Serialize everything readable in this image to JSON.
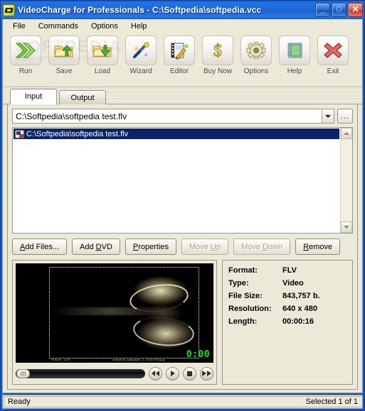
{
  "window": {
    "title": "VideoCharge for Professionals - C:\\Softpedia\\softpedia.vcc",
    "app_icon": "film-reel-icon",
    "minimize_label": "_",
    "maximize_label": "□",
    "close_label": "✕",
    "accent_blue": "#1b62d2",
    "face_color": "#ece9d8"
  },
  "menu": {
    "items": [
      {
        "label": "File"
      },
      {
        "label": "Commands"
      },
      {
        "label": "Options"
      },
      {
        "label": "Help"
      }
    ]
  },
  "toolbar": {
    "watermark": "SOFTPEDIA",
    "watermark_sub": "www.softpedia.com",
    "buttons": [
      {
        "label": "Run",
        "icon": "green-double-chevron-icon"
      },
      {
        "label": "Save",
        "icon": "folder-up-arrow-icon"
      },
      {
        "label": "Load",
        "icon": "folder-down-arrow-icon"
      },
      {
        "label": "Wizard",
        "icon": "magic-wand-icon"
      },
      {
        "label": "Editor",
        "icon": "filmstrip-pencil-icon"
      },
      {
        "label": "Buy Now",
        "icon": "dollar-sign-icon"
      },
      {
        "label": "Options",
        "icon": "gear-icon"
      },
      {
        "label": "Help",
        "icon": "notebook-icon"
      },
      {
        "label": "Exit",
        "icon": "red-x-icon"
      }
    ]
  },
  "tabs": [
    {
      "label": "Input",
      "active": true
    },
    {
      "label": "Output",
      "active": false
    }
  ],
  "input_panel": {
    "path_combo": {
      "value": "C:\\Softpedia\\softpedia test.flv",
      "placeholder": "C:\\Softpedia\\softpedia test.flv"
    },
    "browse_label": "...",
    "file_list": [
      {
        "name": "C:\\Softpedia\\softpedia test.flv",
        "selected": true
      }
    ],
    "buttons": [
      {
        "accel": "A",
        "rest": "dd Files...",
        "disabled": false,
        "name": "add-files-button"
      },
      {
        "pre": "Add ",
        "accel": "D",
        "rest": "VD",
        "disabled": false,
        "name": "add-dvd-button"
      },
      {
        "accel": "P",
        "rest": "roperties",
        "disabled": false,
        "name": "properties-button"
      },
      {
        "pre": "Move ",
        "accel": "U",
        "rest": "p",
        "disabled": true,
        "name": "move-up-button"
      },
      {
        "pre": "Move ",
        "accel": "D",
        "rest": "own",
        "disabled": true,
        "name": "move-down-button"
      },
      {
        "accel": "R",
        "rest": "emove",
        "disabled": false,
        "name": "remove-button"
      }
    ]
  },
  "preview": {
    "timecode": "0:00",
    "overlay_left": "Picture : 1/19",
    "overlay_right": "softpedia_wallpaper_2_1024x768.jpg",
    "transport": [
      {
        "name": "rewind-button",
        "icon": "rewind-icon"
      },
      {
        "name": "play-button",
        "icon": "play-icon"
      },
      {
        "name": "stop-button",
        "icon": "stop-icon"
      },
      {
        "name": "fast-forward-button",
        "icon": "fast-forward-icon"
      }
    ]
  },
  "info": {
    "rows": [
      {
        "key": "Format:",
        "value": "FLV"
      },
      {
        "key": "Type:",
        "value": "Video"
      },
      {
        "key": "File Size:",
        "value": "843,757 b."
      },
      {
        "key": "Resolution:",
        "value": "640 x 480"
      },
      {
        "key": "Length:",
        "value": "00:00:16"
      }
    ]
  },
  "status": {
    "message": "Ready",
    "selection": "Selected 1 of 1"
  }
}
